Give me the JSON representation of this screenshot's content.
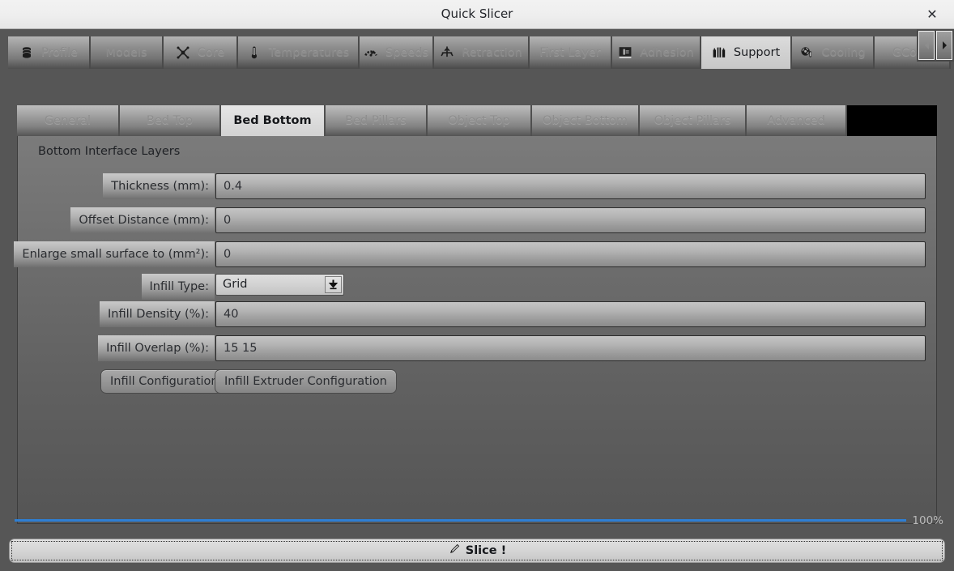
{
  "window": {
    "title": "Quick Slicer",
    "close_label": "✕"
  },
  "tabs": {
    "items": [
      {
        "label": "Profile",
        "icon": "database-icon",
        "active": false
      },
      {
        "label": "Models",
        "icon": "none",
        "active": false
      },
      {
        "label": "Core",
        "icon": "nozzle-icon",
        "active": false
      },
      {
        "label": "Temperatures",
        "icon": "thermometer-icon",
        "active": false
      },
      {
        "label": "Speeds",
        "icon": "gauge-icon",
        "active": false
      },
      {
        "label": "Retraction",
        "icon": "retract-icon",
        "active": false
      },
      {
        "label": "First Layer",
        "icon": "none",
        "active": false
      },
      {
        "label": "Adhesion",
        "icon": "adhesion-icon",
        "active": false
      },
      {
        "label": "Support",
        "icon": "pillars-icon",
        "active": true
      },
      {
        "label": "Cooling",
        "icon": "fan-icon",
        "active": false
      },
      {
        "label": "GCode",
        "icon": "none",
        "active": false
      }
    ],
    "scroll_left_icon": "chevron-left-icon",
    "scroll_right_icon": "chevron-right-icon"
  },
  "subtabs": {
    "items": [
      {
        "label": "General",
        "active": false
      },
      {
        "label": "Bed Top",
        "active": false
      },
      {
        "label": "Bed Bottom",
        "active": true
      },
      {
        "label": "Bed Pillars",
        "active": false
      },
      {
        "label": "Object Top",
        "active": false
      },
      {
        "label": "Object Bottom",
        "active": false
      },
      {
        "label": "Object Pillars",
        "active": false
      },
      {
        "label": "Advanced",
        "active": false
      }
    ]
  },
  "panel": {
    "group_title": "Bottom Interface Layers",
    "fields": [
      {
        "label": "Thickness (mm):",
        "value": "0.4",
        "kind": "text"
      },
      {
        "label": "Offset Distance (mm):",
        "value": "0",
        "kind": "text"
      },
      {
        "label": "Enlarge small surface to (mm²):",
        "value": "0",
        "kind": "text"
      },
      {
        "label": "Infill Type:",
        "value": "Grid",
        "kind": "select"
      },
      {
        "label": "Infill Density (%):",
        "value": "40",
        "kind": "text"
      },
      {
        "label": "Infill Overlap (%):",
        "value": "15 15",
        "kind": "text"
      }
    ],
    "buttons": [
      {
        "label": "Infill Configuration"
      },
      {
        "label": "Infill Extruder Configuration"
      }
    ]
  },
  "status": {
    "progress_percent": "100%",
    "progress_value": 100,
    "slice_label": "Slice !",
    "slice_icon": "knife-icon"
  },
  "colors": {
    "progress": "#2e7fd4",
    "panel_top": "#7b7b7b",
    "panel_bottom": "#555555",
    "active_tab": "#dcdcdc"
  }
}
